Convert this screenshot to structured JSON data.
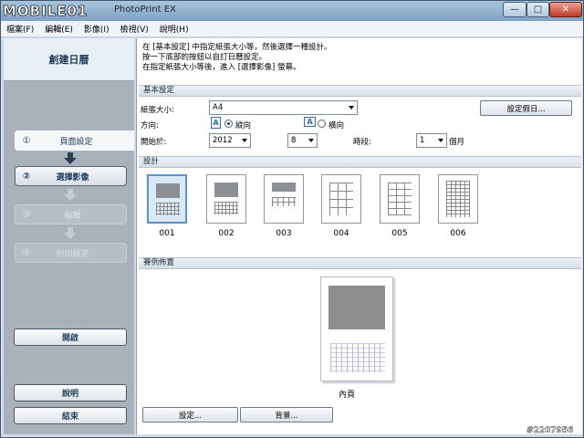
{
  "window": {
    "logo": "MOBILE01",
    "title": "PhotoPrint EX",
    "controls": {
      "minimize": "—",
      "maximize": "□",
      "close": "✕"
    }
  },
  "menu": [
    "檔案(F)",
    "編輯(E)",
    "影像(I)",
    "檢視(V)",
    "說明(H)"
  ],
  "sidebar": {
    "header": "創建日曆",
    "steps": [
      {
        "num": "①",
        "label": "頁面設定",
        "state": "active"
      },
      {
        "num": "②",
        "label": "選擇影像",
        "state": "next"
      },
      {
        "num": "③",
        "label": "編輯",
        "state": "disabled"
      },
      {
        "num": "④",
        "label": "列印設定",
        "state": "disabled"
      }
    ],
    "open_label": "開啟",
    "help_label": "說明",
    "exit_label": "結束"
  },
  "intro": [
    "在 [基本設定] 中指定紙張大小等，然後選擇一種設計。",
    "按一下底部的按鈕以自訂日曆設定。",
    "在指定紙張大小等後，進入 [選擇影像] 螢幕。"
  ],
  "basic": {
    "section": "基本設定",
    "paper_size_label": "紙張大小:",
    "paper_size_value": "A4",
    "holiday_button": "設定假日...",
    "orientation_label": "方向:",
    "orientation_icon": "A",
    "portrait_label": "縱向",
    "landscape_label": "橫向",
    "orientation_selected": "portrait",
    "start_label": "開始於:",
    "start_year": "2012",
    "start_month": "8",
    "period_label": "時段:",
    "period_value": "1",
    "period_unit": "個月"
  },
  "design": {
    "section": "設計",
    "items": [
      {
        "code": "001",
        "selected": true
      },
      {
        "code": "002",
        "selected": false
      },
      {
        "code": "003",
        "selected": false
      },
      {
        "code": "004",
        "selected": false
      },
      {
        "code": "005",
        "selected": false
      },
      {
        "code": "006",
        "selected": false
      }
    ]
  },
  "layout": {
    "section": "賽例佈置",
    "page_label": "內頁",
    "settings_button": "設定...",
    "background_button": "背景..."
  },
  "watermark": "#2207956"
}
